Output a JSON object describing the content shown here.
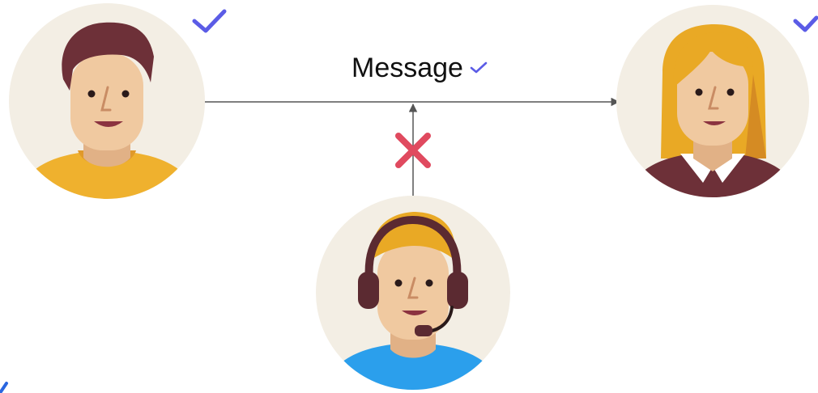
{
  "diagram": {
    "edge_label": "Message",
    "nodes": [
      {
        "id": "sender",
        "kind": "person",
        "verified": true
      },
      {
        "id": "receiver",
        "kind": "person",
        "verified": true
      },
      {
        "id": "eavesdropper",
        "kind": "person-with-headset",
        "blocked": true
      }
    ],
    "edges": [
      {
        "from": "sender",
        "to": "receiver",
        "status": "delivered"
      },
      {
        "from": "eavesdropper",
        "to": "sender-receiver-line",
        "status": "blocked"
      }
    ]
  },
  "colors": {
    "check": "#5b5ce6",
    "cross": "#e04a5f",
    "line": "#555555",
    "avatar_bg": "#f3eee4",
    "skin": "#f0c9a0",
    "skin_shadow": "#e1b186",
    "hair_brown": "#6d3038",
    "hair_blond": "#e9a925",
    "shirt_yellow": "#efb12e",
    "shirt_maroon": "#6d3038",
    "shirt_blue": "#2b9fec",
    "headset": "#5b2a31"
  }
}
